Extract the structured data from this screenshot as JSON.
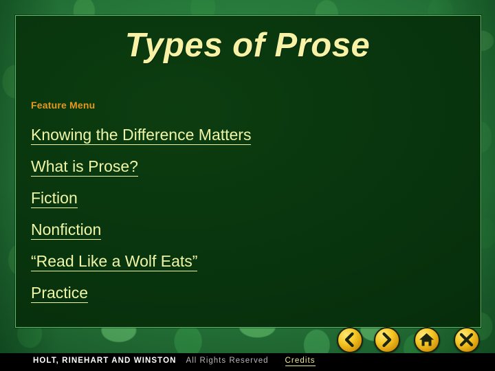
{
  "slide": {
    "title": "Types of Prose",
    "feature_menu_label": "Feature Menu",
    "menu_items": [
      {
        "label": "Knowing the Difference Matters"
      },
      {
        "label": "What is Prose?"
      },
      {
        "label": "Fiction"
      },
      {
        "label": "Nonfiction"
      },
      {
        "label": "“Read Like a Wolf Eats”"
      },
      {
        "label": "Practice"
      }
    ]
  },
  "nav": {
    "previous": {
      "label": "Previous",
      "icon": "chevron-left-icon"
    },
    "next": {
      "label": "Next",
      "icon": "chevron-right-icon"
    },
    "collection_menu": {
      "label": "Collection\nMenu",
      "icon": "home-icon"
    },
    "exit": {
      "label": "Exit",
      "icon": "close-x-icon"
    }
  },
  "footer": {
    "brand": "HOLT, RINEHART AND WINSTON",
    "rights": "All Rights Reserved",
    "credits": "Credits"
  },
  "colors": {
    "title_yellow": "#f7f2a6",
    "link_yellow": "#eef5a8",
    "accent_orange": "#e8981f",
    "panel_dark_green": "#08330d",
    "panel_border_green": "#5fbf6a",
    "background_green": "#2c8240",
    "button_gold": "#f5c927",
    "footer_black": "#000000",
    "footer_white": "#ffffff",
    "footer_gray": "#b9b9b9"
  }
}
